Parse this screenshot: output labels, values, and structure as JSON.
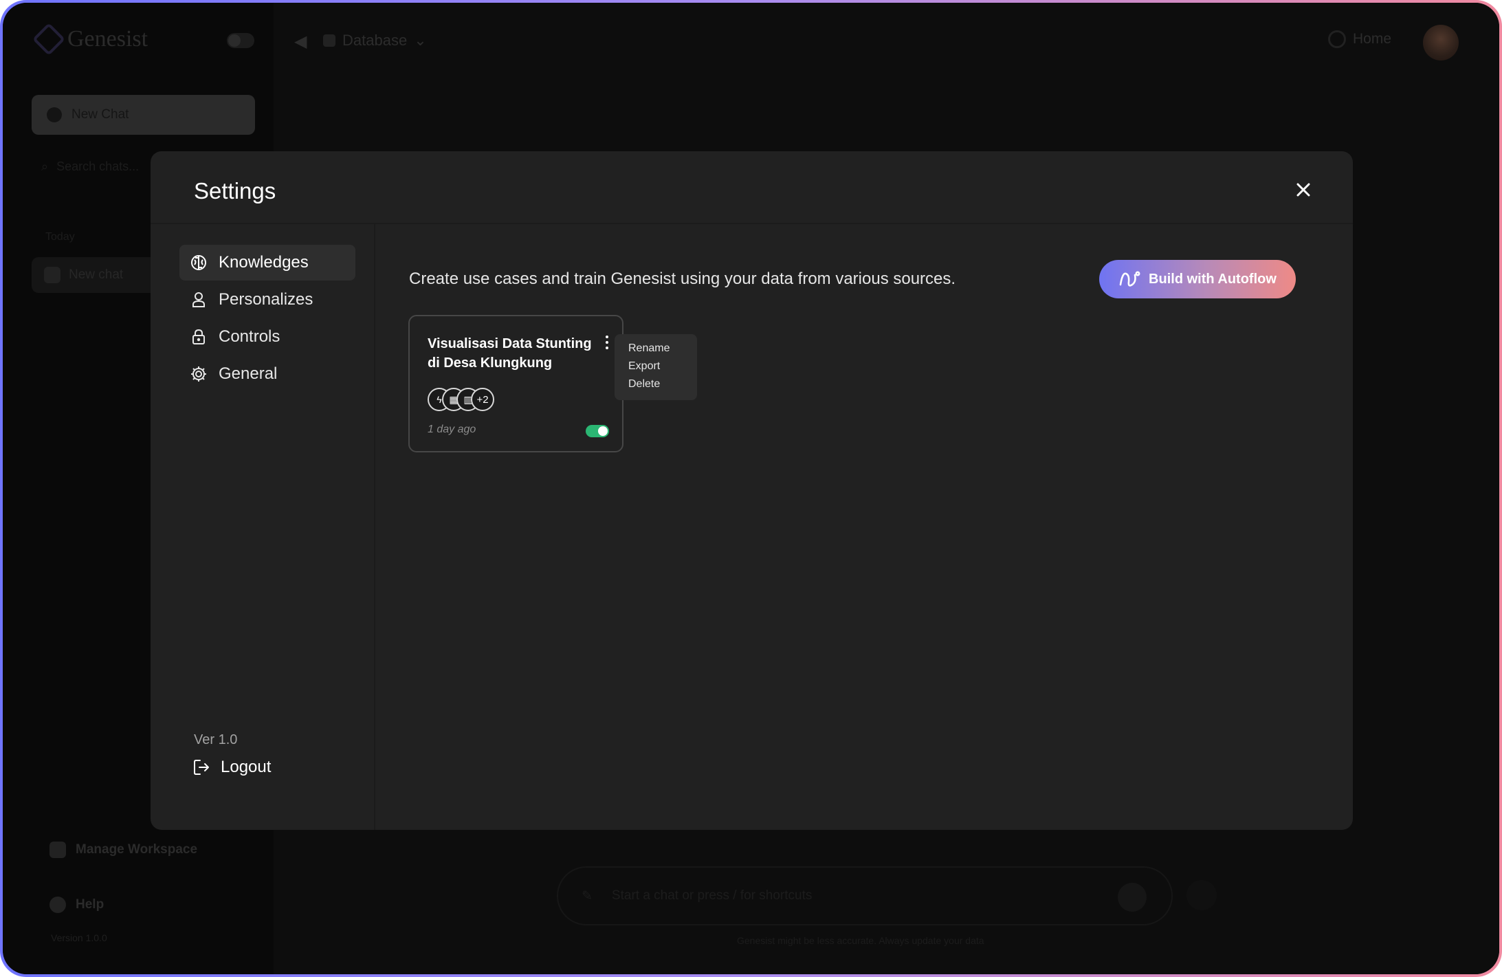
{
  "app": {
    "name": "Genesist",
    "new_chat_button": "New Chat",
    "search_placeholder": "Search chats...",
    "section_today": "Today",
    "chat_item": "New chat",
    "manage_workspace": "Manage Workspace",
    "help": "Help",
    "version": "Version 1.0.0",
    "top_select": "Database",
    "home_button": "Home",
    "chat_placeholder": "Start a chat or press / for shortcuts",
    "disclaimer": "Genesist might be less accurate. Always update your data"
  },
  "settings": {
    "title": "Settings",
    "nav": [
      {
        "label": "Knowledges",
        "icon": "brain-icon",
        "active": true
      },
      {
        "label": "Personalizes",
        "icon": "user-icon",
        "active": false
      },
      {
        "label": "Controls",
        "icon": "lock-icon",
        "active": false
      },
      {
        "label": "General",
        "icon": "gear-icon",
        "active": false
      }
    ],
    "version": "Ver 1.0",
    "logout": "Logout",
    "description": "Create use cases and train Genesist using your data from various sources.",
    "autoflow_button": "Build with Autoflow",
    "card": {
      "title": "Visualisasi Data Stunting di Desa Klungkung",
      "time": "1 day ago",
      "sources_more": "+2",
      "enabled": true
    },
    "context_menu": [
      "Rename",
      "Export",
      "Delete"
    ]
  },
  "colors": {
    "accent_gradient_start": "#6f74f2",
    "accent_gradient_end": "#ee8a86",
    "toggle_on": "#2bb673",
    "modal_bg": "#212121"
  }
}
